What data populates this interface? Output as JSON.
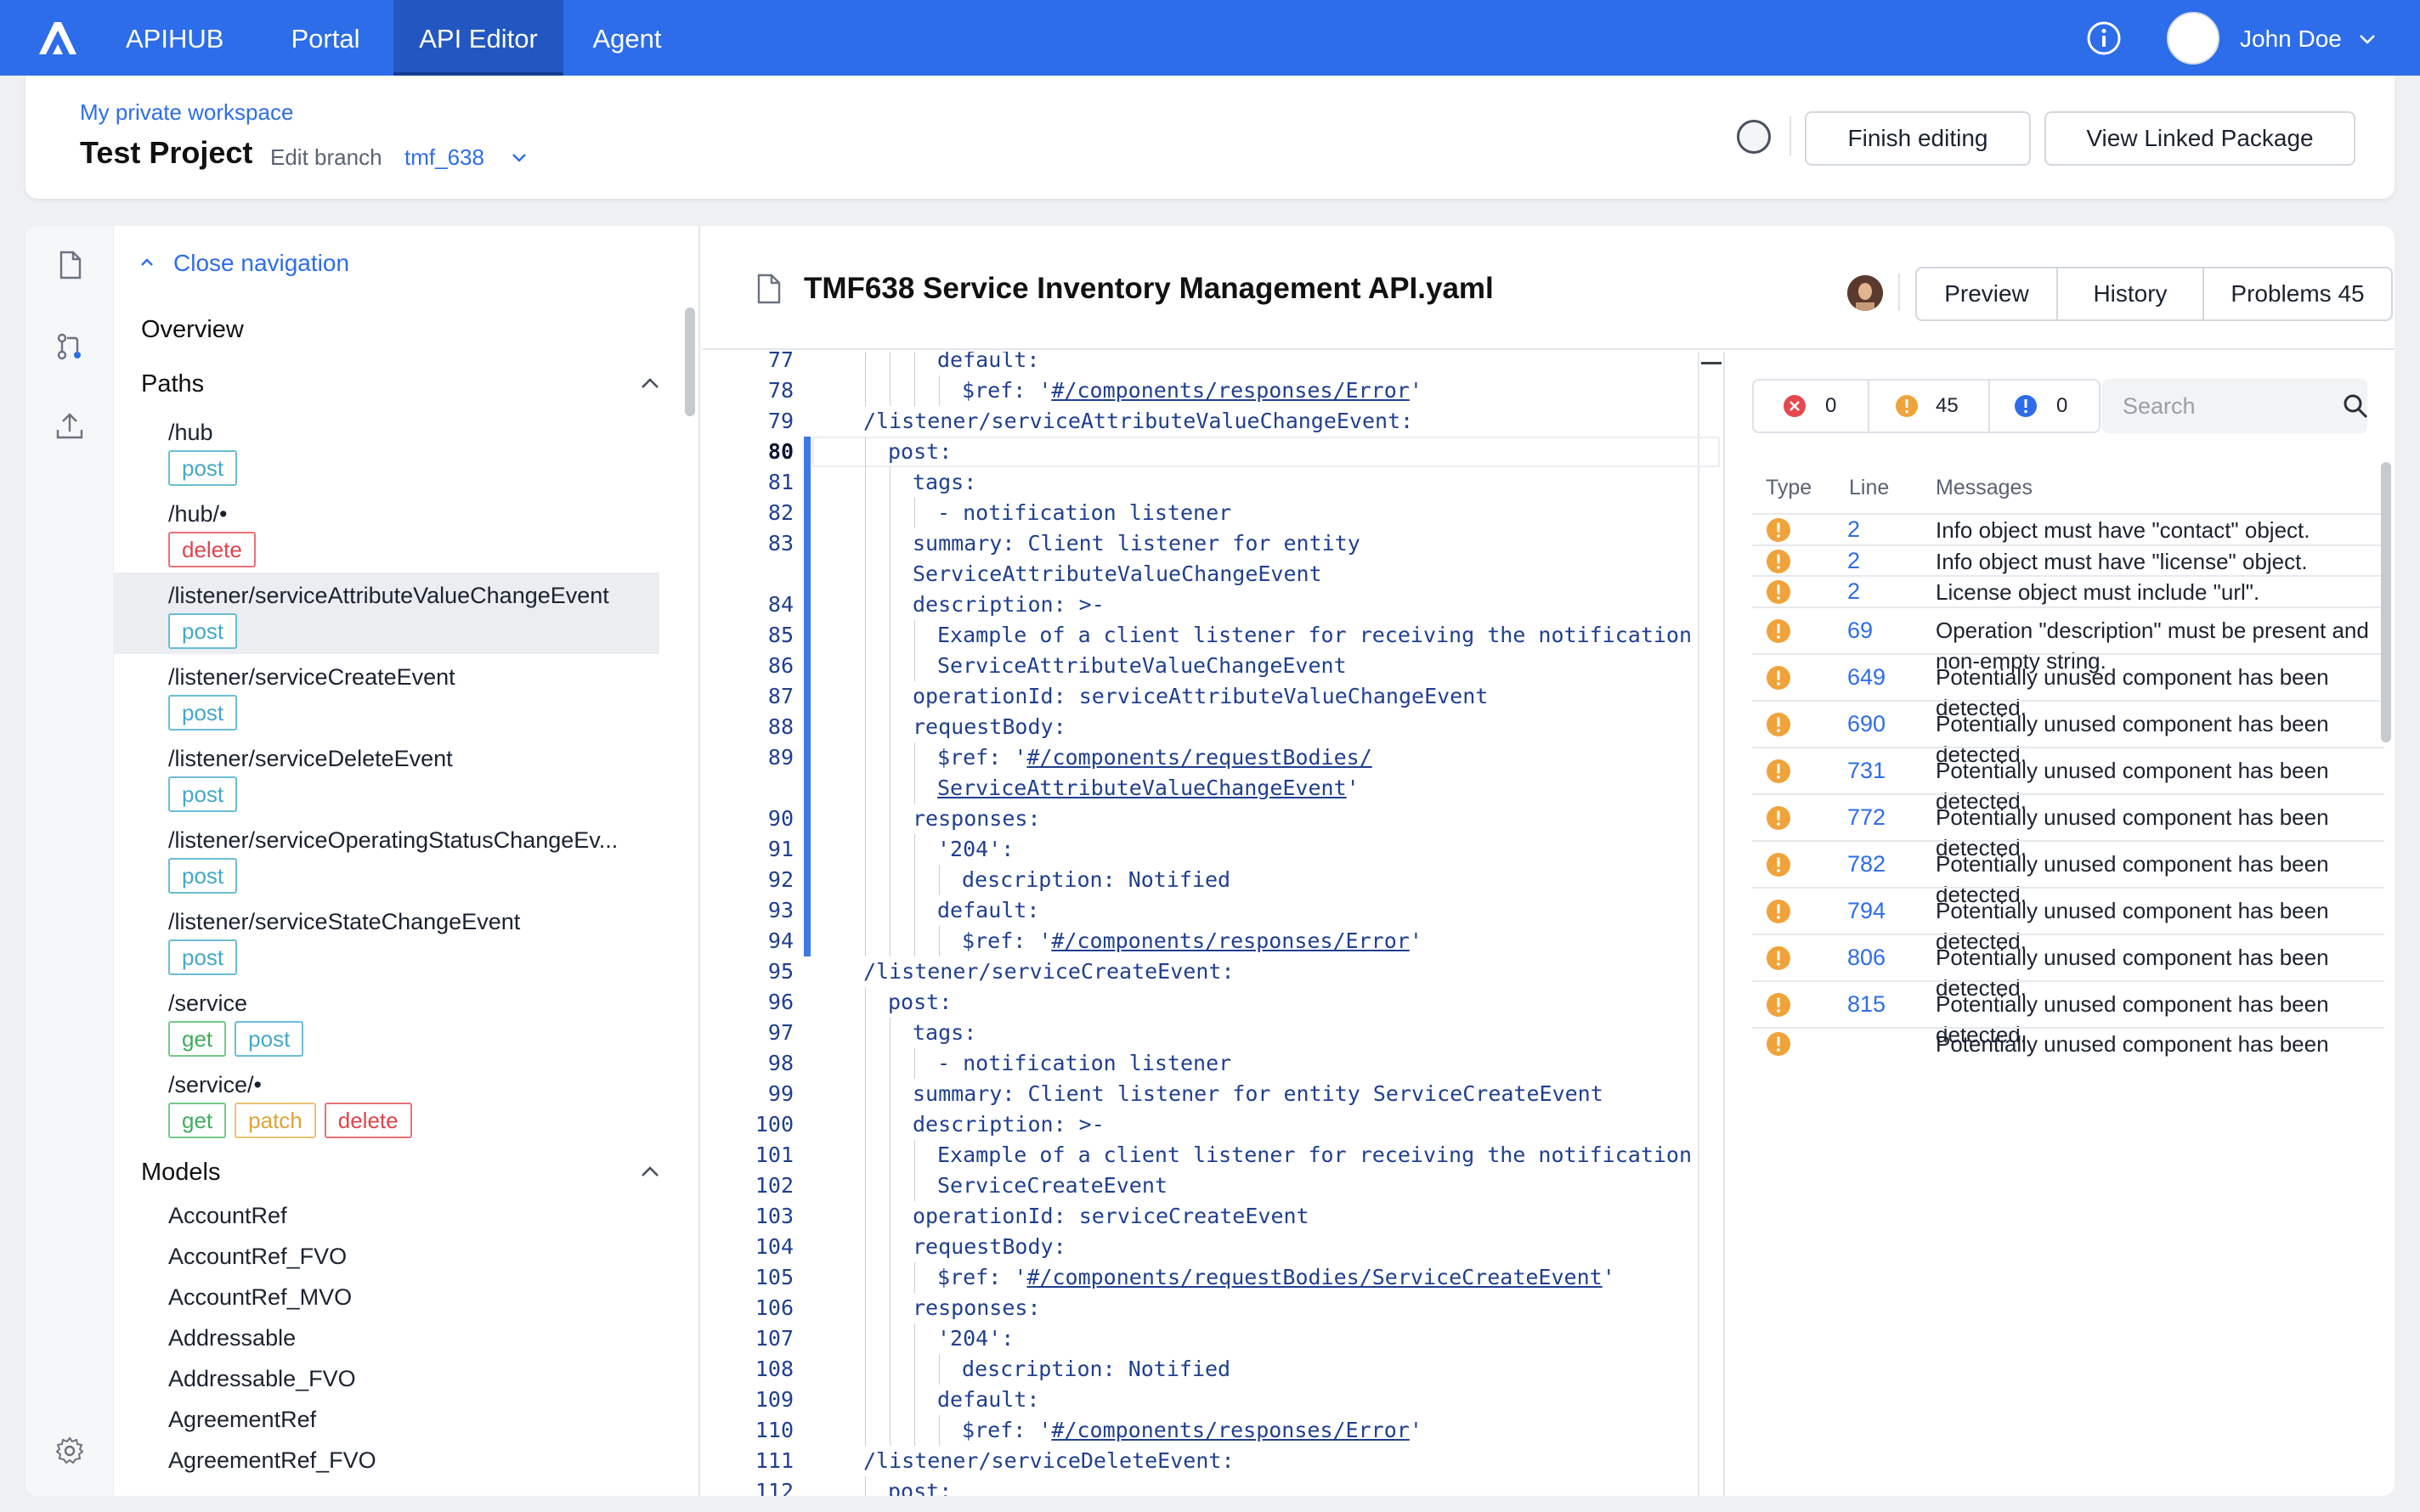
{
  "topbar": {
    "brand": "APIHUB",
    "nav": [
      {
        "label": "Portal"
      },
      {
        "label": "API Editor",
        "active": true
      },
      {
        "label": "Agent"
      }
    ],
    "user_name": "John Doe",
    "colors": {
      "bar": "#2d6de9",
      "active": "#2257c2"
    }
  },
  "workspace": {
    "breadcrumb": "My private workspace",
    "project": "Test Project",
    "branch_label": "Edit branch",
    "branch": "tmf_638",
    "finish_label": "Finish editing",
    "linked_label": "View Linked Package"
  },
  "nav": {
    "close_label": "Close navigation",
    "overview": "Overview",
    "paths_title": "Paths",
    "paths": [
      {
        "path": "/hub",
        "methods": [
          "post"
        ]
      },
      {
        "path": "/hub/•",
        "methods": [
          "delete"
        ]
      },
      {
        "path": "/listener/serviceAttributeValueChangeEvent",
        "methods": [
          "post"
        ],
        "selected": true
      },
      {
        "path": "/listener/serviceCreateEvent",
        "methods": [
          "post"
        ]
      },
      {
        "path": "/listener/serviceDeleteEvent",
        "methods": [
          "post"
        ]
      },
      {
        "path": "/listener/serviceOperatingStatusChangeEv...",
        "methods": [
          "post"
        ]
      },
      {
        "path": "/listener/serviceStateChangeEvent",
        "methods": [
          "post"
        ]
      },
      {
        "path": "/service",
        "methods": [
          "get",
          "post"
        ]
      },
      {
        "path": "/service/•",
        "methods": [
          "get",
          "patch",
          "delete"
        ]
      }
    ],
    "models_title": "Models",
    "models": [
      "AccountRef",
      "AccountRef_FVO",
      "AccountRef_MVO",
      "Addressable",
      "Addressable_FVO",
      "AgreementRef",
      "AgreementRef_FVO"
    ]
  },
  "editor": {
    "filename": "TMF638 Service Inventory Management API.yaml",
    "preview_label": "Preview",
    "history_label": "History",
    "problems_label": "Problems 45",
    "current_line": "80",
    "lines": [
      {
        "n": "77",
        "i": 3,
        "parts": [
          {
            "t": "k",
            "s": "default"
          },
          {
            "t": "p",
            "s": ":"
          }
        ]
      },
      {
        "n": "78",
        "i": 4,
        "parts": [
          {
            "t": "k",
            "s": "$ref"
          },
          {
            "t": "p",
            "s": ": '"
          },
          {
            "t": "r",
            "s": "#/components/responses/Error"
          },
          {
            "t": "p",
            "s": "'"
          }
        ]
      },
      {
        "n": "79",
        "i": 0,
        "parts": [
          {
            "t": "k",
            "s": "/listener/serviceAttributeValueChangeEvent"
          },
          {
            "t": "p",
            "s": ":"
          }
        ]
      },
      {
        "n": "80",
        "i": 1,
        "parts": [
          {
            "t": "k",
            "s": "post"
          },
          {
            "t": "p",
            "s": ":"
          }
        ]
      },
      {
        "n": "81",
        "i": 2,
        "parts": [
          {
            "t": "k",
            "s": "tags"
          },
          {
            "t": "p",
            "s": ":"
          }
        ]
      },
      {
        "n": "82",
        "i": 3,
        "parts": [
          {
            "t": "p",
            "s": "- "
          },
          {
            "t": "v",
            "s": "notification listener"
          }
        ]
      },
      {
        "n": "83",
        "i": 2,
        "parts": [
          {
            "t": "k",
            "s": "summary"
          },
          {
            "t": "p",
            "s": ": "
          },
          {
            "t": "v",
            "s": "Client listener for entity"
          }
        ]
      },
      {
        "n": "",
        "i": 2,
        "parts": [
          {
            "t": "v",
            "s": "ServiceAttributeValueChangeEvent"
          }
        ]
      },
      {
        "n": "84",
        "i": 2,
        "parts": [
          {
            "t": "k",
            "s": "description"
          },
          {
            "t": "p",
            "s": ": >-"
          }
        ]
      },
      {
        "n": "85",
        "i": 3,
        "parts": [
          {
            "t": "v",
            "s": "Example of a client listener for receiving the notification"
          }
        ]
      },
      {
        "n": "86",
        "i": 3,
        "parts": [
          {
            "t": "v",
            "s": "ServiceAttributeValueChangeEvent"
          }
        ]
      },
      {
        "n": "87",
        "i": 2,
        "parts": [
          {
            "t": "k",
            "s": "operationId"
          },
          {
            "t": "p",
            "s": ": "
          },
          {
            "t": "v",
            "s": "serviceAttributeValueChangeEvent"
          }
        ]
      },
      {
        "n": "88",
        "i": 2,
        "parts": [
          {
            "t": "k",
            "s": "requestBody"
          },
          {
            "t": "p",
            "s": ":"
          }
        ]
      },
      {
        "n": "89",
        "i": 3,
        "parts": [
          {
            "t": "k",
            "s": "$ref"
          },
          {
            "t": "p",
            "s": ": '"
          },
          {
            "t": "r",
            "s": "#/components/requestBodies/"
          }
        ]
      },
      {
        "n": "",
        "i": 3,
        "parts": [
          {
            "t": "r",
            "s": "ServiceAttributeValueChangeEvent"
          },
          {
            "t": "p",
            "s": "'"
          }
        ]
      },
      {
        "n": "90",
        "i": 2,
        "parts": [
          {
            "t": "k",
            "s": "responses"
          },
          {
            "t": "p",
            "s": ":"
          }
        ]
      },
      {
        "n": "91",
        "i": 3,
        "parts": [
          {
            "t": "v",
            "s": "'204'"
          },
          {
            "t": "p",
            "s": ":"
          }
        ]
      },
      {
        "n": "92",
        "i": 4,
        "parts": [
          {
            "t": "k",
            "s": "description"
          },
          {
            "t": "p",
            "s": ": "
          },
          {
            "t": "v",
            "s": "Notified"
          }
        ]
      },
      {
        "n": "93",
        "i": 3,
        "parts": [
          {
            "t": "k",
            "s": "default"
          },
          {
            "t": "p",
            "s": ":"
          }
        ]
      },
      {
        "n": "94",
        "i": 4,
        "parts": [
          {
            "t": "k",
            "s": "$ref"
          },
          {
            "t": "p",
            "s": ": '"
          },
          {
            "t": "r",
            "s": "#/components/responses/Error"
          },
          {
            "t": "p",
            "s": "'"
          }
        ]
      },
      {
        "n": "95",
        "i": 0,
        "parts": [
          {
            "t": "k",
            "s": "/listener/serviceCreateEvent"
          },
          {
            "t": "p",
            "s": ":"
          }
        ]
      },
      {
        "n": "96",
        "i": 1,
        "parts": [
          {
            "t": "k",
            "s": "post"
          },
          {
            "t": "p",
            "s": ":"
          }
        ]
      },
      {
        "n": "97",
        "i": 2,
        "parts": [
          {
            "t": "k",
            "s": "tags"
          },
          {
            "t": "p",
            "s": ":"
          }
        ]
      },
      {
        "n": "98",
        "i": 3,
        "parts": [
          {
            "t": "p",
            "s": "- "
          },
          {
            "t": "v",
            "s": "notification listener"
          }
        ]
      },
      {
        "n": "99",
        "i": 2,
        "parts": [
          {
            "t": "k",
            "s": "summary"
          },
          {
            "t": "p",
            "s": ": "
          },
          {
            "t": "v",
            "s": "Client listener for entity ServiceCreateEvent"
          }
        ]
      },
      {
        "n": "100",
        "i": 2,
        "parts": [
          {
            "t": "k",
            "s": "description"
          },
          {
            "t": "p",
            "s": ": >-"
          }
        ]
      },
      {
        "n": "101",
        "i": 3,
        "parts": [
          {
            "t": "v",
            "s": "Example of a client listener for receiving the notification"
          }
        ]
      },
      {
        "n": "102",
        "i": 3,
        "parts": [
          {
            "t": "v",
            "s": "ServiceCreateEvent"
          }
        ]
      },
      {
        "n": "103",
        "i": 2,
        "parts": [
          {
            "t": "k",
            "s": "operationId"
          },
          {
            "t": "p",
            "s": ": "
          },
          {
            "t": "v",
            "s": "serviceCreateEvent"
          }
        ]
      },
      {
        "n": "104",
        "i": 2,
        "parts": [
          {
            "t": "k",
            "s": "requestBody"
          },
          {
            "t": "p",
            "s": ":"
          }
        ]
      },
      {
        "n": "105",
        "i": 3,
        "parts": [
          {
            "t": "k",
            "s": "$ref"
          },
          {
            "t": "p",
            "s": ": '"
          },
          {
            "t": "r",
            "s": "#/components/requestBodies/ServiceCreateEvent"
          },
          {
            "t": "p",
            "s": "'"
          }
        ]
      },
      {
        "n": "106",
        "i": 2,
        "parts": [
          {
            "t": "k",
            "s": "responses"
          },
          {
            "t": "p",
            "s": ":"
          }
        ]
      },
      {
        "n": "107",
        "i": 3,
        "parts": [
          {
            "t": "v",
            "s": "'204'"
          },
          {
            "t": "p",
            "s": ":"
          }
        ]
      },
      {
        "n": "108",
        "i": 4,
        "parts": [
          {
            "t": "k",
            "s": "description"
          },
          {
            "t": "p",
            "s": ": "
          },
          {
            "t": "v",
            "s": "Notified"
          }
        ]
      },
      {
        "n": "109",
        "i": 3,
        "parts": [
          {
            "t": "k",
            "s": "default"
          },
          {
            "t": "p",
            "s": ":"
          }
        ]
      },
      {
        "n": "110",
        "i": 4,
        "parts": [
          {
            "t": "k",
            "s": "$ref"
          },
          {
            "t": "p",
            "s": ": '"
          },
          {
            "t": "r",
            "s": "#/components/responses/Error"
          },
          {
            "t": "p",
            "s": "'"
          }
        ]
      },
      {
        "n": "111",
        "i": 0,
        "parts": [
          {
            "t": "k",
            "s": "/listener/serviceDeleteEvent"
          },
          {
            "t": "p",
            "s": ":"
          }
        ]
      },
      {
        "n": "112",
        "i": 1,
        "parts": [
          {
            "t": "k",
            "s": "post"
          },
          {
            "t": "p",
            "s": ":"
          }
        ]
      }
    ]
  },
  "problems": {
    "error_count": "0",
    "warning_count": "45",
    "info_count": "0",
    "search_placeholder": "Search",
    "headers": {
      "type": "Type",
      "line": "Line",
      "messages": "Messages"
    },
    "rows": [
      {
        "line": "2",
        "message": "Info object must have \"contact\" object."
      },
      {
        "line": "2",
        "message": "Info object must have \"license\" object."
      },
      {
        "line": "2",
        "message": "License object must include \"url\"."
      },
      {
        "line": "69",
        "message": "Operation \"description\" must be present and non-empty string."
      },
      {
        "line": "649",
        "message": "Potentially unused component has been detected."
      },
      {
        "line": "690",
        "message": "Potentially unused component has been detected."
      },
      {
        "line": "731",
        "message": "Potentially unused component has been detected."
      },
      {
        "line": "772",
        "message": "Potentially unused component has been detected."
      },
      {
        "line": "782",
        "message": "Potentially unused component has been detected."
      },
      {
        "line": "794",
        "message": "Potentially unused component has been detected."
      },
      {
        "line": "806",
        "message": "Potentially unused component has been detected."
      },
      {
        "line": "815",
        "message": "Potentially unused component has been detected."
      },
      {
        "line": "",
        "message": "Potentially unused component has been"
      }
    ],
    "colors": {
      "error": "#e5484d",
      "warning": "#f0a33a",
      "info": "#2d6de9"
    }
  }
}
